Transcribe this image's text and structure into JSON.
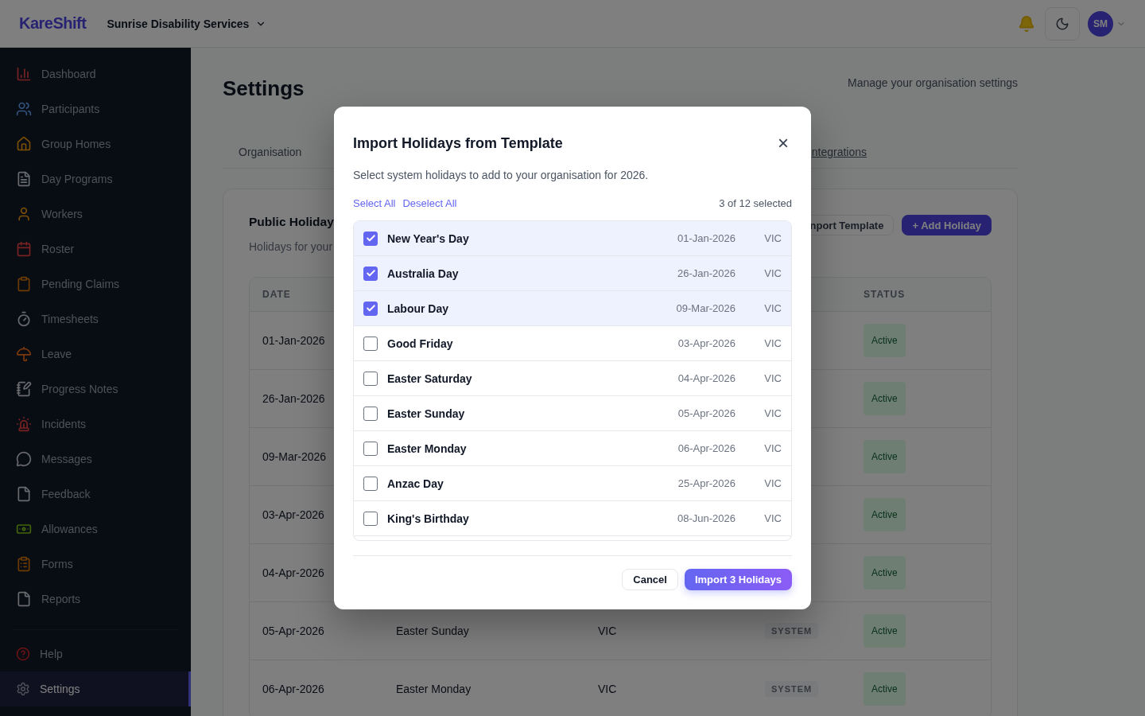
{
  "header": {
    "logo": "KareShift",
    "organisation": "Sunrise Disability Services",
    "avatar": "SM"
  },
  "sidebar": {
    "items": [
      {
        "label": "Dashboard",
        "selected": false
      },
      {
        "label": "Participants",
        "selected": false
      },
      {
        "label": "Group Homes",
        "selected": false
      },
      {
        "label": "Day Programs",
        "selected": false
      },
      {
        "label": "Workers",
        "selected": false
      },
      {
        "label": "Roster",
        "selected": false
      },
      {
        "label": "Pending Claims",
        "selected": false
      },
      {
        "label": "Timesheets",
        "selected": false
      },
      {
        "label": "Leave",
        "selected": false
      },
      {
        "label": "Progress Notes",
        "selected": false
      },
      {
        "label": "Incidents",
        "selected": false
      },
      {
        "label": "Messages",
        "selected": false
      },
      {
        "label": "Feedback",
        "selected": false
      },
      {
        "label": "Allowances",
        "selected": false
      },
      {
        "label": "Forms",
        "selected": false
      },
      {
        "label": "Reports",
        "selected": false
      }
    ],
    "footer_items": [
      {
        "label": "Help",
        "selected": false
      },
      {
        "label": "Settings",
        "selected": true
      }
    ]
  },
  "page": {
    "title": "Settings",
    "subtitle": "Manage your organisation settings",
    "tabs": [
      {
        "label": "Organisation",
        "hovered": false
      },
      {
        "label": "ntegrations",
        "hovered": true
      }
    ]
  },
  "card": {
    "title": "Public Holiday",
    "subtitle": "Holidays for your",
    "buttons": [
      {
        "label": "nport Template",
        "kind": "outline"
      },
      {
        "label": "+ Add Holiday",
        "kind": "primary"
      }
    ],
    "table": {
      "columns": [
        "DATE",
        "STATUS"
      ],
      "rows": [
        {
          "date": "01-Jan-2026",
          "status": "Active"
        },
        {
          "date": "26-Jan-2026",
          "status": "Active"
        },
        {
          "date": "09-Mar-2026",
          "status": "Active"
        },
        {
          "date": "03-Apr-2026",
          "status": "Active"
        },
        {
          "date": "04-Apr-2026",
          "status": "Active"
        },
        {
          "date": "05-Apr-2026",
          "name": "Easter Sunday",
          "state": "VIC",
          "type": "SYSTEM",
          "status": "Active"
        },
        {
          "date": "06-Apr-2026",
          "name": "Easter Monday",
          "state": "VIC",
          "type": "SYSTEM",
          "status": "Active"
        }
      ]
    }
  },
  "dialog": {
    "title": "Import Holidays from Template",
    "close": "×",
    "description": "Select system holidays to add to your organisation for 2026.",
    "select_all": "Select All",
    "deselect_all": "Deselect All",
    "count": "3 of 12 selected",
    "holidays": [
      {
        "name": "New Year's Day",
        "date": "01-Jan-2026",
        "state": "VIC",
        "checked": true
      },
      {
        "name": "Australia Day",
        "date": "26-Jan-2026",
        "state": "VIC",
        "checked": true
      },
      {
        "name": "Labour Day",
        "date": "09-Mar-2026",
        "state": "VIC",
        "checked": true
      },
      {
        "name": "Good Friday",
        "date": "03-Apr-2026",
        "state": "VIC",
        "checked": false
      },
      {
        "name": "Easter Saturday",
        "date": "04-Apr-2026",
        "state": "VIC",
        "checked": false
      },
      {
        "name": "Easter Sunday",
        "date": "05-Apr-2026",
        "state": "VIC",
        "checked": false
      },
      {
        "name": "Easter Monday",
        "date": "06-Apr-2026",
        "state": "VIC",
        "checked": false
      },
      {
        "name": "Anzac Day",
        "date": "25-Apr-2026",
        "state": "VIC",
        "checked": false
      },
      {
        "name": "King's Birthday",
        "date": "08-Jun-2026",
        "state": "VIC",
        "checked": false
      }
    ],
    "cancel": "Cancel",
    "confirm": "Import 3 Holidays"
  }
}
